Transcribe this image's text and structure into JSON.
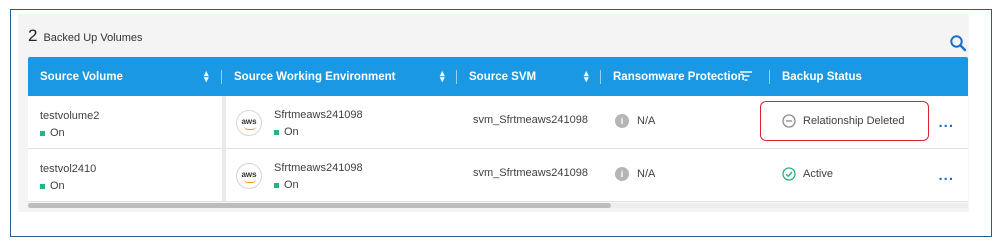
{
  "header": {
    "count": "2",
    "label": "Backed Up Volumes"
  },
  "icons": {
    "search": "search-icon",
    "more": "ellipsis-icon",
    "info": "info-icon"
  },
  "colors": {
    "header_bg": "#1a98e3",
    "status_on": "#2ab27b",
    "active": "#2ab27b",
    "highlight": "#d8242a",
    "more": "#1a6fc9"
  },
  "columns": [
    {
      "label": "Source Volume"
    },
    {
      "label": "Source Working Environment"
    },
    {
      "label": "Source SVM"
    },
    {
      "label": "Ransomware Protection"
    },
    {
      "label": "Backup Status"
    }
  ],
  "rows": [
    {
      "volume": "testvolume2",
      "volume_status": "On",
      "env_logo": "aws",
      "env": "Sfrtmeaws241098",
      "env_status": "On",
      "svm": "svm_Sfrtmeaws241098",
      "ransomware": "N/A",
      "backup_status": "Relationship Deleted",
      "more": "..."
    },
    {
      "volume": "testvol2410",
      "volume_status": "On",
      "env_logo": "aws",
      "env": "Sfrtmeaws241098",
      "env_status": "On",
      "svm": "svm_Sfrtmeaws241098",
      "ransomware": "N/A",
      "backup_status": "Active",
      "more": "..."
    }
  ],
  "scroll": {
    "thumb_fraction": 0.62
  }
}
